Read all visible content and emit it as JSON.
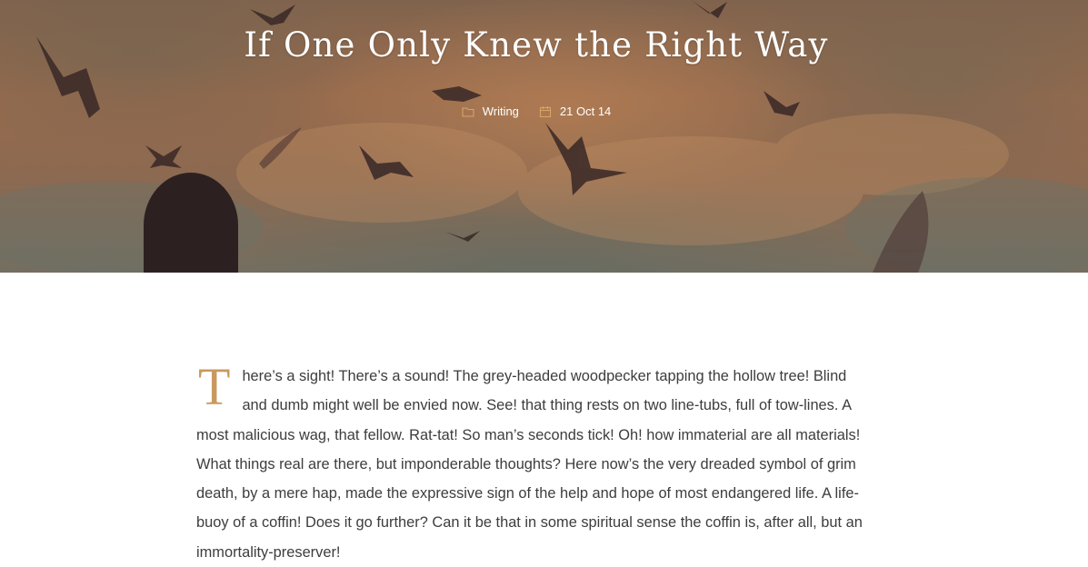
{
  "post": {
    "title": "If One Only Knew the Right Way",
    "meta": {
      "category": "Writing",
      "date": "21 Oct 14"
    },
    "body": {
      "drop_cap": "T",
      "text": "here’s a sight! There’s a sound! The grey-headed woodpecker tapping the hollow tree! Blind and dumb might well be envied now. See! that thing rests on two line-tubs, full of tow-lines. A most malicious wag, that fellow. Rat-tat! So man’s seconds tick! Oh! how immaterial are all materials! What things real are there, but imponderable thoughts? Here now’s the very dreaded symbol of grim death, by a mere hap, made the expressive sign of the help and hope of most endangered life. A life-buoy of a coffin! Does it go further? Can it be that in some spiritual sense the coffin is, after all, but an immortality-preserver!"
    }
  },
  "colors": {
    "accent": "#c9995f",
    "body_text": "#3d3d3d",
    "title_text": "#ffffff",
    "icon": "#d8a466"
  },
  "icons": {
    "category": "folder-icon",
    "date": "calendar-icon"
  }
}
